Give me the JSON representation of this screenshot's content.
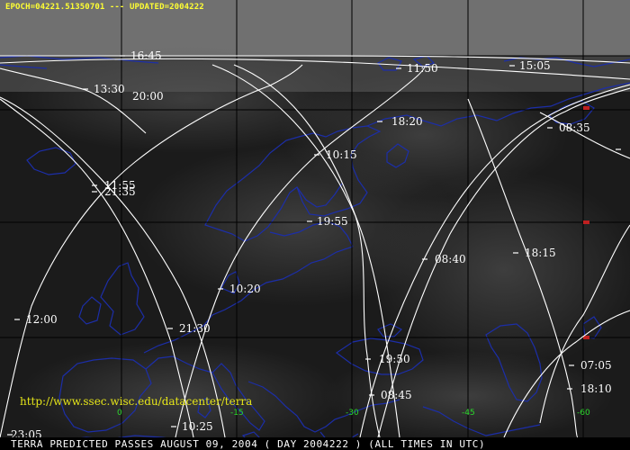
{
  "header": {
    "text": "EPOCH=04221.51350701 --- UPDATED=2004222"
  },
  "url": "http://www.ssec.wisc.edu/datacenter/terra",
  "footer": "TERRA PREDICTED PASSES AUGUST 09, 2004  ( DAY 2004222 )  (ALL TIMES IN UTC)",
  "longitudes": [
    "0",
    "-15",
    "-30",
    "-45",
    "-60"
  ],
  "colors": {
    "background": "#1b1b1b",
    "coastline": "#1c2ea8",
    "grid": "#000000",
    "tracks": "#ffffff",
    "header": "#ffff33",
    "longitude_labels": "#2bd92b",
    "markers": "#c02020"
  },
  "time_labels": [
    "16:45",
    "11:50",
    "15:05",
    "13:30",
    "20:00",
    "18:20",
    "08:35",
    "10:15",
    "11:55",
    "21:35",
    "19:55",
    "08:40",
    "18:15",
    "10:20",
    "12:00",
    "21:30",
    "19:50",
    "07:05",
    "08:45",
    "18:10",
    "10:25",
    "23:05"
  ]
}
